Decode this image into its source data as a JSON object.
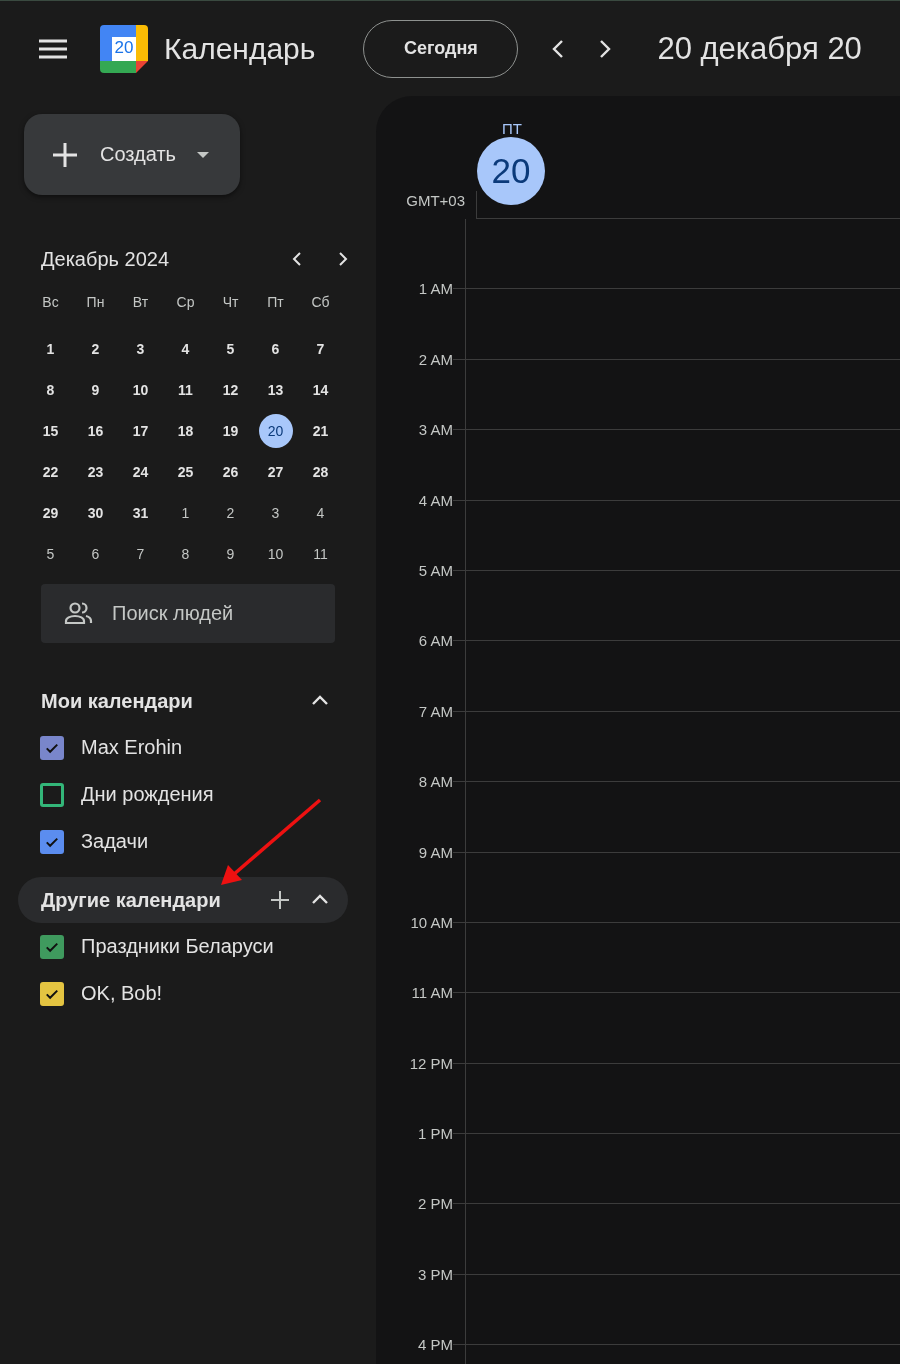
{
  "header": {
    "app_name": "Календарь",
    "logo_day": "20",
    "today_button": "Сегодня",
    "date_title": "20 декабря 20"
  },
  "create_button": "Создать",
  "mini_calendar": {
    "title": "Декабрь 2024",
    "weekdays": [
      "Вс",
      "Пн",
      "Вт",
      "Ср",
      "Чт",
      "Пт",
      "Сб"
    ],
    "weeks": [
      [
        {
          "day": "1",
          "outside": false,
          "selected": false
        },
        {
          "day": "2",
          "outside": false,
          "selected": false
        },
        {
          "day": "3",
          "outside": false,
          "selected": false
        },
        {
          "day": "4",
          "outside": false,
          "selected": false
        },
        {
          "day": "5",
          "outside": false,
          "selected": false
        },
        {
          "day": "6",
          "outside": false,
          "selected": false
        },
        {
          "day": "7",
          "outside": false,
          "selected": false
        }
      ],
      [
        {
          "day": "8",
          "outside": false,
          "selected": false
        },
        {
          "day": "9",
          "outside": false,
          "selected": false
        },
        {
          "day": "10",
          "outside": false,
          "selected": false
        },
        {
          "day": "11",
          "outside": false,
          "selected": false
        },
        {
          "day": "12",
          "outside": false,
          "selected": false
        },
        {
          "day": "13",
          "outside": false,
          "selected": false
        },
        {
          "day": "14",
          "outside": false,
          "selected": false
        }
      ],
      [
        {
          "day": "15",
          "outside": false,
          "selected": false
        },
        {
          "day": "16",
          "outside": false,
          "selected": false
        },
        {
          "day": "17",
          "outside": false,
          "selected": false
        },
        {
          "day": "18",
          "outside": false,
          "selected": false
        },
        {
          "day": "19",
          "outside": false,
          "selected": false
        },
        {
          "day": "20",
          "outside": false,
          "selected": true
        },
        {
          "day": "21",
          "outside": false,
          "selected": false
        }
      ],
      [
        {
          "day": "22",
          "outside": false,
          "selected": false
        },
        {
          "day": "23",
          "outside": false,
          "selected": false
        },
        {
          "day": "24",
          "outside": false,
          "selected": false
        },
        {
          "day": "25",
          "outside": false,
          "selected": false
        },
        {
          "day": "26",
          "outside": false,
          "selected": false
        },
        {
          "day": "27",
          "outside": false,
          "selected": false
        },
        {
          "day": "28",
          "outside": false,
          "selected": false
        }
      ],
      [
        {
          "day": "29",
          "outside": false,
          "selected": false
        },
        {
          "day": "30",
          "outside": false,
          "selected": false
        },
        {
          "day": "31",
          "outside": false,
          "selected": false
        },
        {
          "day": "1",
          "outside": true,
          "selected": false
        },
        {
          "day": "2",
          "outside": true,
          "selected": false
        },
        {
          "day": "3",
          "outside": true,
          "selected": false
        },
        {
          "day": "4",
          "outside": true,
          "selected": false
        }
      ],
      [
        {
          "day": "5",
          "outside": true,
          "selected": false
        },
        {
          "day": "6",
          "outside": true,
          "selected": false
        },
        {
          "day": "7",
          "outside": true,
          "selected": false
        },
        {
          "day": "8",
          "outside": true,
          "selected": false
        },
        {
          "day": "9",
          "outside": true,
          "selected": false
        },
        {
          "day": "10",
          "outside": true,
          "selected": false
        },
        {
          "day": "11",
          "outside": true,
          "selected": false
        }
      ]
    ]
  },
  "people_search": {
    "placeholder": "Поиск людей"
  },
  "my_calendars": {
    "title": "Мои календари",
    "expanded": true,
    "items": [
      {
        "name": "Max Erohin",
        "checked": true,
        "color": "#7986cb"
      },
      {
        "name": "Дни рождения",
        "checked": false,
        "color": "#33b679"
      },
      {
        "name": "Задачи",
        "checked": true,
        "color": "#5b8def"
      }
    ]
  },
  "other_calendars": {
    "title": "Другие календари",
    "expanded": true,
    "items": [
      {
        "name": "Праздники Беларуси",
        "checked": true,
        "color": "#3f9a5e"
      },
      {
        "name": "OK, Bob!",
        "checked": true,
        "color": "#e4c441"
      }
    ]
  },
  "day_view": {
    "weekday": "ПТ",
    "day": "20",
    "today": true,
    "timezone": "GMT+03",
    "hours": [
      "1 AM",
      "2 AM",
      "3 AM",
      "4 AM",
      "5 AM",
      "6 AM",
      "7 AM",
      "8 AM",
      "9 AM",
      "10 AM",
      "11 AM",
      "12 PM",
      "1 PM",
      "2 PM",
      "3 PM",
      "4 PM"
    ]
  }
}
